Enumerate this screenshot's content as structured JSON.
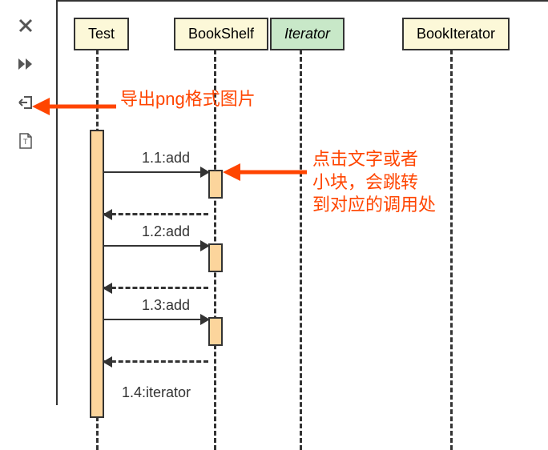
{
  "toolbar": {
    "close": "close",
    "fastforward": "fast-forward",
    "export": "export",
    "text": "text"
  },
  "lifelines": {
    "test": "Test",
    "bookshelf": "BookShelf",
    "iterator": "Iterator",
    "bookiterator": "BookIterator"
  },
  "messages": {
    "m1": "1.1:add",
    "m2": "1.2:add",
    "m3": "1.3:add",
    "m4": "1.4:iterator"
  },
  "annotations": {
    "export_png": "导出png格式图片",
    "click_jump": "点击文字或者\n小块，会跳转\n到对应的调用处"
  },
  "colors": {
    "yellow_bg": "#fcf8d8",
    "green_bg": "#c8e8c8",
    "activation": "#fcd59c",
    "annotation": "#ff4500"
  }
}
